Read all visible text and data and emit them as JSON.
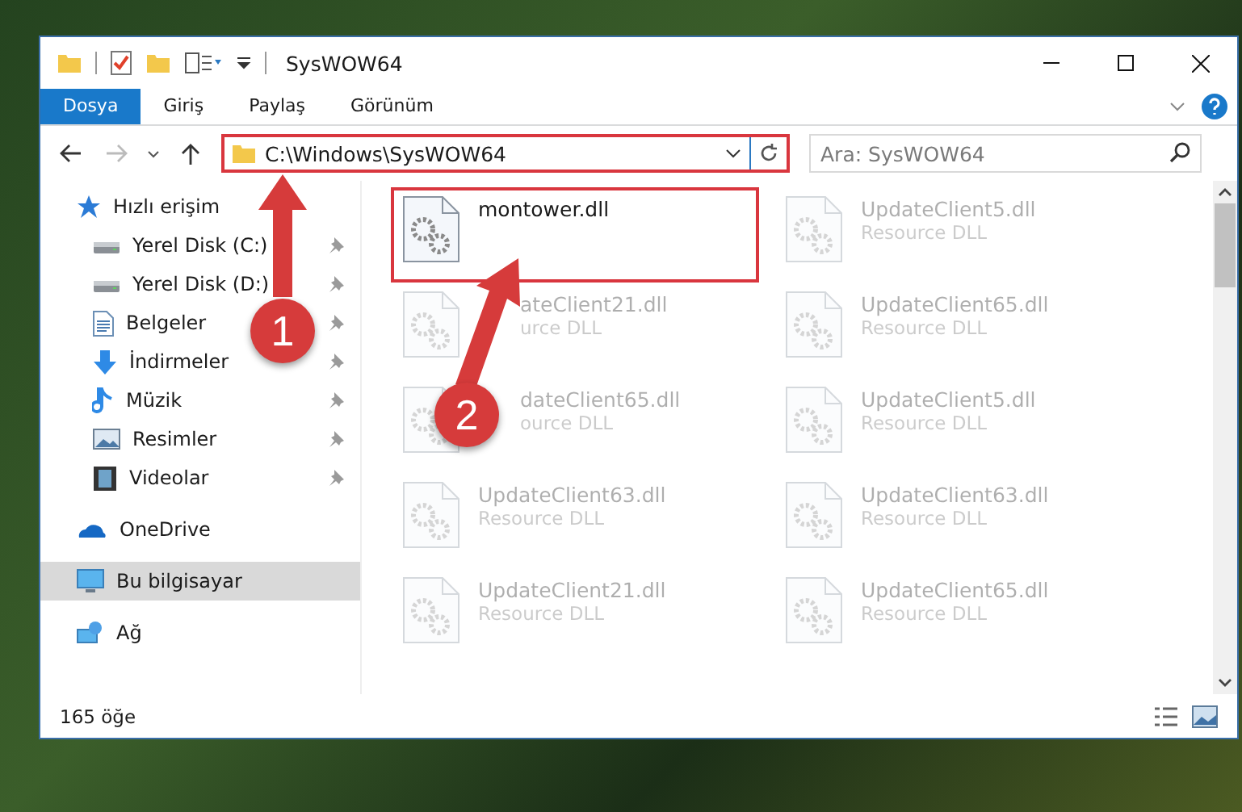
{
  "window": {
    "title": "SysWOW64"
  },
  "ribbon_tabs": [
    {
      "label": "Dosya",
      "selected": true
    },
    {
      "label": "Giriş",
      "selected": false
    },
    {
      "label": "Paylaş",
      "selected": false
    },
    {
      "label": "Görünüm",
      "selected": false
    }
  ],
  "address_bar": {
    "path": "C:\\Windows\\SysWOW64",
    "highlighted": true
  },
  "search": {
    "placeholder": "Ara: SysWOW64"
  },
  "sidebar": {
    "items": [
      {
        "label": "Hızlı erişim",
        "kind": "star",
        "selected": false,
        "children": [
          {
            "label": "Yerel Disk (C:)",
            "kind": "drive",
            "pinned": true,
            "selected": false
          },
          {
            "label": "Yerel Disk (D:)",
            "kind": "drive",
            "pinned": true,
            "selected": false
          },
          {
            "label": "Belgeler",
            "kind": "document",
            "pinned": true,
            "selected": false
          },
          {
            "label": "İndirmeler",
            "kind": "download",
            "pinned": true,
            "selected": false
          },
          {
            "label": "Müzik",
            "kind": "music",
            "pinned": true,
            "selected": false
          },
          {
            "label": "Resimler",
            "kind": "picture",
            "pinned": true,
            "selected": false
          },
          {
            "label": "Videolar",
            "kind": "video",
            "pinned": true,
            "selected": false
          }
        ]
      },
      {
        "label": "OneDrive",
        "kind": "cloud",
        "selected": false
      },
      {
        "label": "Bu bilgisayar",
        "kind": "computer",
        "selected": true
      },
      {
        "label": "Ağ",
        "kind": "network",
        "selected": false
      }
    ]
  },
  "files": [
    {
      "name": "montower.dll",
      "highlighted": true,
      "dimmed": false
    },
    {
      "name": "UpdateClient5.dll",
      "description": "Resource DLL",
      "highlighted": false,
      "dimmed": true
    },
    {
      "name": "ateClient21.dll",
      "description": "urce DLL",
      "highlighted": false,
      "dimmed": true,
      "partly_hidden": true
    },
    {
      "name": "UpdateClient65.dll",
      "description": "Resource DLL",
      "highlighted": false,
      "dimmed": true
    },
    {
      "name": "dateClient65.dll",
      "description": "ource DLL",
      "highlighted": false,
      "dimmed": true,
      "partly_hidden": true
    },
    {
      "name": "UpdateClient5.dll",
      "description": "Resource DLL",
      "highlighted": false,
      "dimmed": true
    },
    {
      "name": "UpdateClient63.dll",
      "description": "Resource DLL",
      "highlighted": false,
      "dimmed": true
    },
    {
      "name": "UpdateClient63.dll",
      "description": "Resource DLL",
      "highlighted": false,
      "dimmed": true
    },
    {
      "name": "UpdateClient21.dll",
      "description": "Resource DLL",
      "highlighted": false,
      "dimmed": true
    },
    {
      "name": "UpdateClient65.dll",
      "description": "Resource DLL",
      "highlighted": false,
      "dimmed": true
    }
  ],
  "status_bar": {
    "item_count": "165 öğe"
  },
  "annotations": [
    {
      "number": "1"
    },
    {
      "number": "2"
    }
  ]
}
